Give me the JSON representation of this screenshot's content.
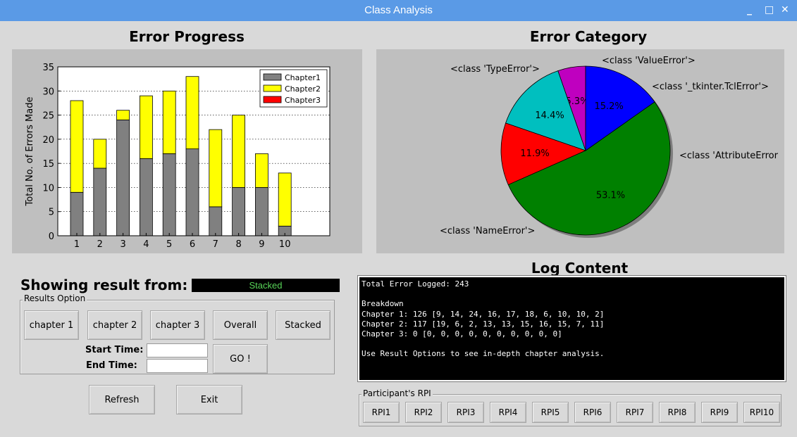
{
  "window": {
    "title": "Class Analysis",
    "controls": [
      "_",
      "□",
      "✕"
    ]
  },
  "headings": {
    "error_progress": "Error Progress",
    "error_category": "Error Category",
    "log_content": "Log Content"
  },
  "bar_chart_data": {
    "type": "bar",
    "stacked": true,
    "categories": [
      "1",
      "2",
      "3",
      "4",
      "5",
      "6",
      "7",
      "8",
      "9",
      "10"
    ],
    "series": [
      {
        "name": "Chapter1",
        "color": "#808080",
        "values": [
          9,
          14,
          24,
          16,
          17,
          18,
          6,
          10,
          10,
          2
        ]
      },
      {
        "name": "Chapter2",
        "color": "#ffff00",
        "values": [
          19,
          6,
          2,
          13,
          13,
          15,
          16,
          15,
          7,
          11
        ]
      },
      {
        "name": "Chapter3",
        "color": "#ff0000",
        "values": [
          0,
          0,
          0,
          0,
          0,
          0,
          0,
          0,
          0,
          0
        ]
      }
    ],
    "ylabel": "Total No. of Errors Made",
    "ylim": [
      0,
      35
    ],
    "yticks": [
      "0",
      "5",
      "10",
      "15",
      "20",
      "25",
      "30",
      "35"
    ],
    "grid": true,
    "legend": "top-right"
  },
  "pie_chart_data": {
    "type": "pie",
    "slices": [
      {
        "label": "<class 'ValueError'>",
        "pct": "5.3%",
        "value": 5.3,
        "color": "#bf00bf"
      },
      {
        "label": "<class '_tkinter.TclError'>",
        "pct": "14.4%",
        "value": 14.4,
        "color": "#00bfbf"
      },
      {
        "label": "<class 'AttributeError",
        "pct": "11.9%",
        "value": 11.9,
        "color": "#ff0000"
      },
      {
        "label": "<class 'NameError'>",
        "pct": "53.1%",
        "value": 53.1,
        "color": "#008000"
      },
      {
        "label": "<class 'TypeError'>",
        "pct": "15.2%",
        "value": 15.2,
        "color": "#0000ff"
      }
    ],
    "shadow": true
  },
  "showing": {
    "label": "Showing result from:",
    "value": "Stacked"
  },
  "results_option": {
    "title": "Results Option",
    "buttons": [
      "chapter 1",
      "chapter 2",
      "chapter 3",
      "Overall",
      "Stacked"
    ],
    "start_label": "Start Time:",
    "end_label": "End Time:",
    "start_value": "",
    "end_value": "",
    "go_label": "GO !"
  },
  "actions": {
    "refresh": "Refresh",
    "exit": "Exit"
  },
  "log": {
    "lines": [
      "Total Error Logged: 243",
      "",
      "Breakdown",
      "Chapter 1: 126 [9, 14, 24, 16, 17, 18, 6, 10, 10, 2]",
      "Chapter 2: 117 [19, 6, 2, 13, 13, 15, 16, 15, 7, 11]",
      "Chapter 3: 0 [0, 0, 0, 0, 0, 0, 0, 0, 0, 0]",
      "",
      "Use Result Options to see in-depth chapter analysis."
    ]
  },
  "participants": {
    "title": "Participant's RPI",
    "buttons": [
      "RPI1",
      "RPI2",
      "RPI3",
      "RPI4",
      "RPI5",
      "RPI6",
      "RPI7",
      "RPI8",
      "RPI9",
      "RPI10"
    ]
  }
}
